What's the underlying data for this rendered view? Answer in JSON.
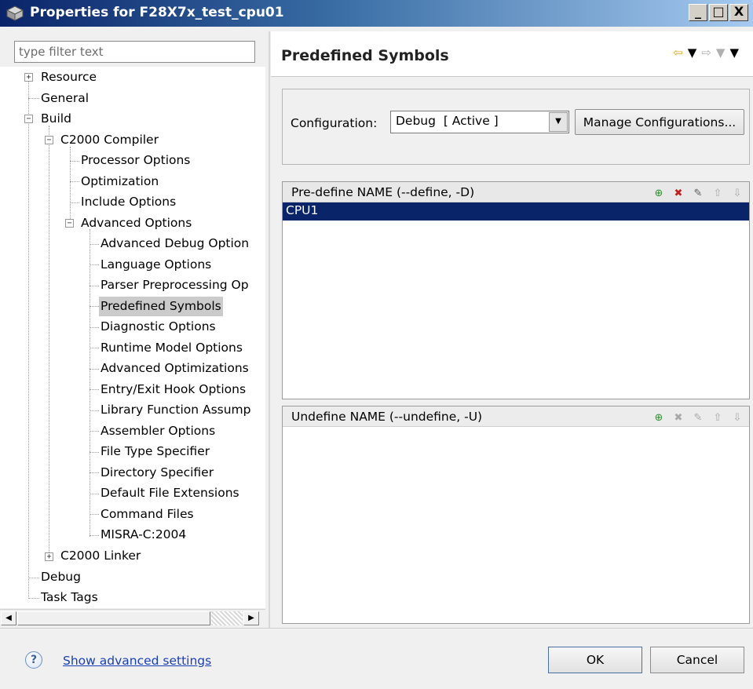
{
  "window": {
    "title": "Properties for F28X7x_test_cpu01",
    "minimize_glyph": "_",
    "maximize_glyph": "□",
    "close_glyph": "X"
  },
  "filter": {
    "placeholder": "type filter text",
    "value": ""
  },
  "tree": {
    "items": [
      {
        "label": "Resource",
        "expander": "+"
      },
      {
        "label": "General"
      },
      {
        "label": "Build",
        "expander": "−"
      },
      {
        "label": "C2000 Compiler",
        "expander": "−"
      },
      {
        "label": "Processor Options"
      },
      {
        "label": "Optimization"
      },
      {
        "label": "Include Options"
      },
      {
        "label": "Advanced Options",
        "expander": "−"
      },
      {
        "label": "Advanced Debug Option"
      },
      {
        "label": "Language Options"
      },
      {
        "label": "Parser Preprocessing Op"
      },
      {
        "label": "Predefined Symbols",
        "selected": true
      },
      {
        "label": "Diagnostic Options"
      },
      {
        "label": "Runtime Model Options"
      },
      {
        "label": "Advanced Optimizations"
      },
      {
        "label": "Entry/Exit Hook Options"
      },
      {
        "label": "Library Function Assump"
      },
      {
        "label": "Assembler Options"
      },
      {
        "label": "File Type Specifier"
      },
      {
        "label": "Directory Specifier"
      },
      {
        "label": "Default File Extensions"
      },
      {
        "label": "Command Files"
      },
      {
        "label": "MISRA-C:2004"
      },
      {
        "label": "C2000 Linker",
        "expander": "+"
      },
      {
        "label": "Debug"
      },
      {
        "label": "Task Tags"
      }
    ]
  },
  "scrollbar": {
    "left_glyph": "◀",
    "right_glyph": "▶"
  },
  "page": {
    "title": "Predefined Symbols"
  },
  "nav": {
    "back_glyph": "⇦",
    "menu_glyph": "▼",
    "forward_glyph": "⇨"
  },
  "configuration": {
    "label": "Configuration:",
    "selected": "Debug  [ Active ]",
    "dropdown_glyph": "▼",
    "manage_label": "Manage Configurations..."
  },
  "predefine": {
    "title": "Pre-define NAME (--define, -D)",
    "items": [
      "CPU1"
    ]
  },
  "undefine": {
    "title": "Undefine NAME (--undefine, -U)",
    "items": []
  },
  "tool_glyphs": {
    "add": "⊕",
    "delete": "✖",
    "edit": "✎",
    "up": "⇧",
    "down": "⇩"
  },
  "footer": {
    "help_glyph": "?",
    "advanced_link": "Show advanced settings",
    "ok_label": "OK",
    "cancel_label": "Cancel"
  }
}
